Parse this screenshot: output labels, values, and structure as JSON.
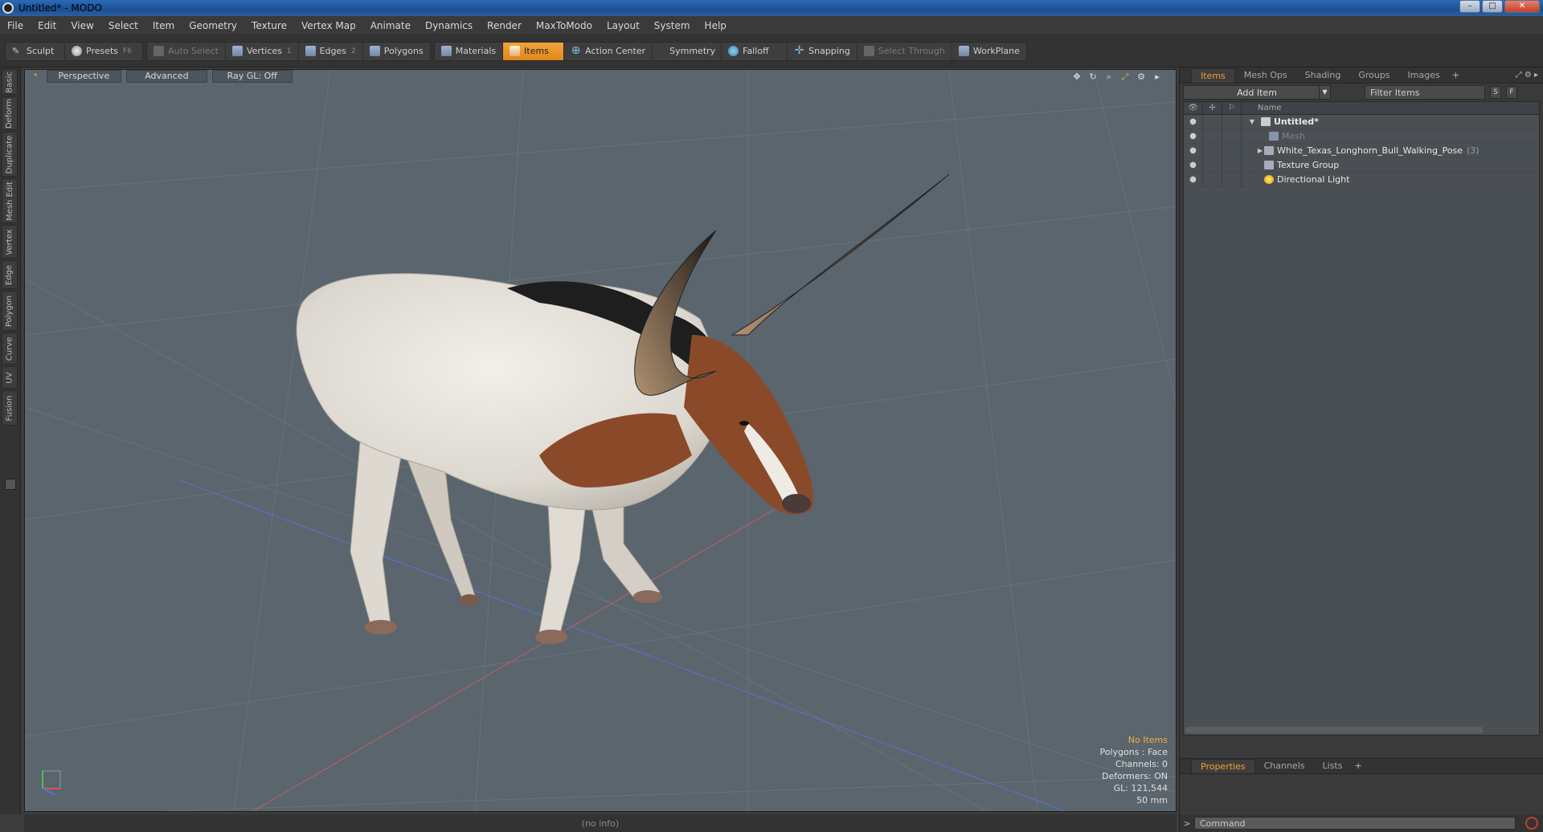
{
  "window": {
    "title": "Untitled* - MODO"
  },
  "menu": [
    "File",
    "Edit",
    "View",
    "Select",
    "Item",
    "Geometry",
    "Texture",
    "Vertex Map",
    "Animate",
    "Dynamics",
    "Render",
    "MaxToModo",
    "Layout",
    "System",
    "Help"
  ],
  "toolbar": {
    "sculpt": "Sculpt",
    "presets": "Presets",
    "presets_key": "F6",
    "auto_select": "Auto Select",
    "vertices": "Vertices",
    "vertices_key": "1",
    "edges": "Edges",
    "edges_key": "2",
    "polygons": "Polygons",
    "materials": "Materials",
    "items": "Items",
    "action_center": "Action Center",
    "symmetry": "Symmetry",
    "falloff": "Falloff",
    "snapping": "Snapping",
    "select_through": "Select Through",
    "workplane": "WorkPlane"
  },
  "left_tabs": [
    "Basic",
    "Deform",
    "Duplicate",
    "Mesh Edit",
    "Vertex",
    "Edge",
    "Polygon",
    "Curve",
    "UV",
    "Fusion"
  ],
  "viewport": {
    "view": "Perspective",
    "shading": "Advanced",
    "raygl": "Ray GL: Off",
    "stats": {
      "selection": "No Items",
      "polygons": "Polygons : Face",
      "channels": "Channels: 0",
      "deformers": "Deformers: ON",
      "gl": "GL: 121,544",
      "size": "50 mm"
    }
  },
  "status": {
    "info": "(no info)"
  },
  "right_panel": {
    "tabs": [
      "Items",
      "Mesh Ops",
      "Shading",
      "Groups",
      "Images"
    ],
    "add_item": "Add Item",
    "filter_placeholder": "Filter Items",
    "btn_s": "S",
    "btn_f": "F",
    "name_header": "Name",
    "tree": {
      "root": "Untitled*",
      "mesh": "Mesh",
      "bull": "White_Texas_Longhorn_Bull_Walking_Pose",
      "bull_count": "(3)",
      "texture_group": "Texture Group",
      "light": "Directional Light"
    },
    "bottom_tabs": [
      "Properties",
      "Channels",
      "Lists"
    ],
    "command_prompt": ">",
    "command_placeholder": "Command"
  },
  "colors": {
    "accent": "#f0a030",
    "viewport_bg": "#5a656d",
    "panel_bg": "#3a3a3a"
  },
  "icons": {
    "sculpt": "brush-icon",
    "presets": "presets-icon",
    "falloff": "falloff-icon",
    "snapping": "snapping-icon"
  }
}
